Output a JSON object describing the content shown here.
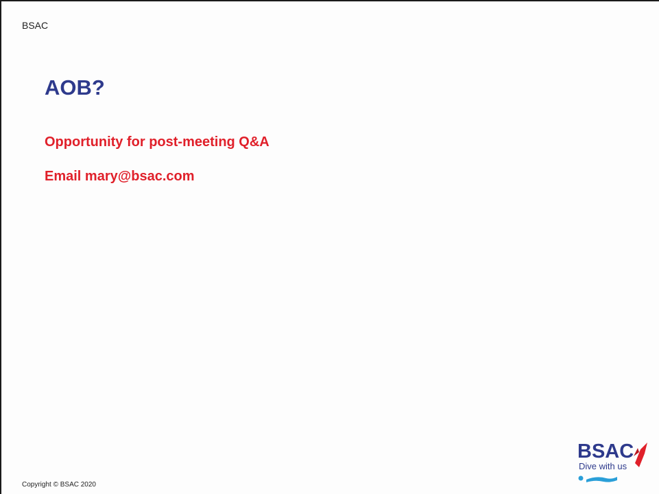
{
  "header": {
    "org": "BSAC"
  },
  "title": "AOB?",
  "bullets": [
    "Opportunity for post-meeting Q&A",
    "Email mary@bsac.com"
  ],
  "footer": {
    "copyright": "Copyright © BSAC 2020"
  },
  "logo": {
    "wordmark": "BSAC",
    "tagline": "Dive with us",
    "wordmark_color": "#2e3a8c",
    "accent_color": "#e0202a",
    "wave_color": "#2a9fd8"
  }
}
